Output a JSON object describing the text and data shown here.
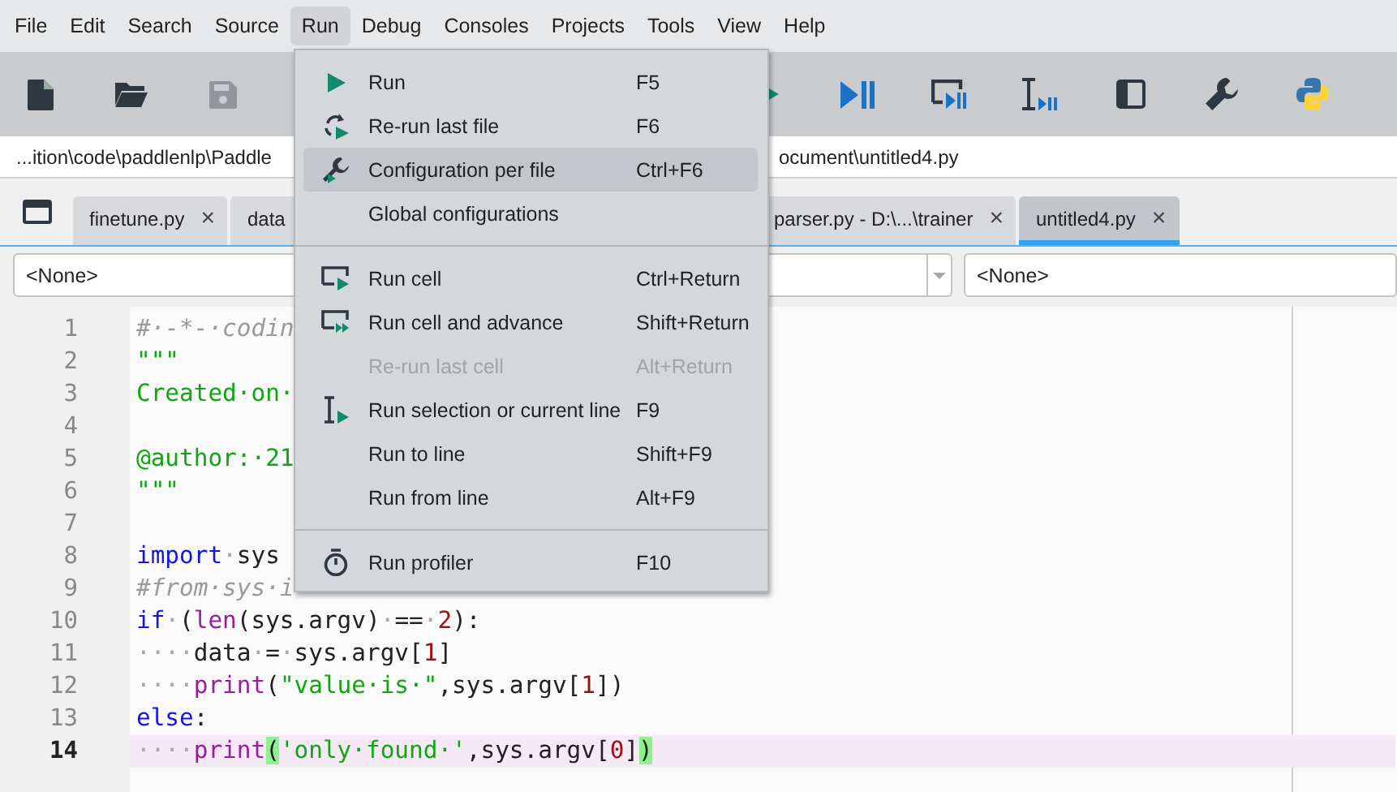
{
  "menubar": [
    {
      "label": "File",
      "selected": false
    },
    {
      "label": "Edit",
      "selected": false
    },
    {
      "label": "Search",
      "selected": false
    },
    {
      "label": "Source",
      "selected": false
    },
    {
      "label": "Run",
      "selected": true
    },
    {
      "label": "Debug",
      "selected": false
    },
    {
      "label": "Consoles",
      "selected": false
    },
    {
      "label": "Projects",
      "selected": false
    },
    {
      "label": "Tools",
      "selected": false
    },
    {
      "label": "View",
      "selected": false
    },
    {
      "label": "Help",
      "selected": false
    }
  ],
  "toolbar": {
    "left_buttons": [
      {
        "disabled": false
      },
      {
        "disabled": false
      },
      {
        "disabled": true
      }
    ],
    "right_buttons": [
      {
        "disabled": false
      },
      {
        "disabled": false
      },
      {
        "disabled": false
      },
      {
        "disabled": false
      },
      {
        "disabled": false
      },
      {
        "disabled": false
      },
      {
        "disabled": false
      }
    ]
  },
  "path_bar": {
    "text_left": "...ition\\code\\paddlenlp\\Paddle",
    "text_right": "ocument\\untitled4.py"
  },
  "tabs": [
    {
      "label": "finetune.py",
      "close": "×",
      "selected": false
    },
    {
      "label": "data",
      "selected": false
    },
    {
      "label": "parser.py - D:\\...\\trainer",
      "close": "×",
      "selected": false
    },
    {
      "label": "untitled4.py",
      "close": "×",
      "selected": true
    }
  ],
  "selectors": [
    {
      "value": "<None>"
    },
    {
      "value": "<None>"
    }
  ],
  "editor": {
    "lines": [
      {
        "number": "1",
        "current": false,
        "tokens": [
          {
            "kind": "comment",
            "text": "#·-*-·codin"
          }
        ]
      },
      {
        "number": "2",
        "current": false,
        "tokens": [
          {
            "kind": "string",
            "text": "\"\"\""
          }
        ]
      },
      {
        "number": "3",
        "current": false,
        "tokens": [
          {
            "kind": "string",
            "text": "Created·on·"
          }
        ]
      },
      {
        "number": "4",
        "current": false
      },
      {
        "number": "5",
        "current": false,
        "tokens": [
          {
            "kind": "string",
            "text": "@author:·21"
          }
        ]
      },
      {
        "number": "6",
        "current": false,
        "tokens": [
          {
            "kind": "string",
            "text": "\"\"\""
          }
        ]
      },
      {
        "number": "7",
        "current": false
      },
      {
        "number": "8",
        "current": false,
        "tokens": [
          {
            "kind": "keyword",
            "text": "import"
          },
          {
            "kind": "space",
            "text": "·"
          },
          {
            "kind": "plain",
            "text": "sys"
          }
        ]
      },
      {
        "number": "9",
        "current": false,
        "tokens": [
          {
            "kind": "comment",
            "text": "#from·sys·i"
          }
        ]
      },
      {
        "number": "10",
        "current": false,
        "tokens": [
          {
            "kind": "keyword",
            "text": "if"
          },
          {
            "kind": "space",
            "text": "·"
          },
          {
            "kind": "plain",
            "text": "("
          },
          {
            "kind": "builtin",
            "text": "len"
          },
          {
            "kind": "plain",
            "text": "(sys.argv)"
          },
          {
            "kind": "space",
            "text": "·"
          },
          {
            "kind": "plain",
            "text": "=="
          },
          {
            "kind": "space",
            "text": "·"
          },
          {
            "kind": "number",
            "text": "2"
          },
          {
            "kind": "plain",
            "text": "):"
          }
        ]
      },
      {
        "number": "11",
        "current": false,
        "tokens": [
          {
            "kind": "space",
            "text": "····"
          },
          {
            "kind": "plain",
            "text": "data"
          },
          {
            "kind": "space",
            "text": "·"
          },
          {
            "kind": "plain",
            "text": "="
          },
          {
            "kind": "space",
            "text": "·"
          },
          {
            "kind": "plain",
            "text": "sys.argv["
          },
          {
            "kind": "number",
            "text": "1"
          },
          {
            "kind": "plain",
            "text": "]"
          }
        ]
      },
      {
        "number": "12",
        "current": false,
        "tokens": [
          {
            "kind": "space",
            "text": "····"
          },
          {
            "kind": "builtin",
            "text": "print"
          },
          {
            "kind": "plain",
            "text": "("
          },
          {
            "kind": "string",
            "text": "\"value·is·\""
          },
          {
            "kind": "plain",
            "text": ",sys.argv["
          },
          {
            "kind": "number",
            "text": "1"
          },
          {
            "kind": "plain",
            "text": "])"
          }
        ]
      },
      {
        "number": "13",
        "current": false,
        "tokens": [
          {
            "kind": "keyword",
            "text": "else"
          },
          {
            "kind": "plain",
            "text": ":"
          }
        ]
      },
      {
        "number": "14",
        "current": true,
        "tokens": [
          {
            "kind": "space",
            "text": "····"
          },
          {
            "kind": "builtin",
            "text": "print"
          },
          {
            "kind": "match",
            "text": "("
          },
          {
            "kind": "string",
            "text": "'only·found·'"
          },
          {
            "kind": "plain",
            "text": ",sys.argv["
          },
          {
            "kind": "number",
            "text": "0"
          },
          {
            "kind": "plain",
            "text": "]"
          },
          {
            "kind": "match",
            "text": ")"
          }
        ]
      }
    ]
  },
  "run_menu": {
    "groups": [
      [
        {
          "label": "Run",
          "shortcut": "F5",
          "disabled": false,
          "selected": false
        },
        {
          "label": "Re-run last file",
          "shortcut": "F6",
          "disabled": false,
          "selected": false
        },
        {
          "label": "Configuration per file",
          "shortcut": "Ctrl+F6",
          "disabled": false,
          "selected": true
        },
        {
          "label": "Global configurations",
          "disabled": false,
          "selected": false
        }
      ],
      [
        {
          "label": "Run cell",
          "shortcut": "Ctrl+Return",
          "disabled": false,
          "selected": false
        },
        {
          "label": "Run cell and advance",
          "shortcut": "Shift+Return",
          "disabled": false,
          "selected": false
        },
        {
          "label": "Re-run last cell",
          "shortcut": "Alt+Return",
          "disabled": true,
          "selected": false
        },
        {
          "label": "Run selection or current line",
          "shortcut": "F9",
          "disabled": false,
          "selected": false
        },
        {
          "label": "Run to line",
          "shortcut": "Shift+F9",
          "disabled": false,
          "selected": false
        },
        {
          "label": "Run from line",
          "shortcut": "Alt+F9",
          "disabled": false,
          "selected": false
        }
      ],
      [
        {
          "label": "Run profiler",
          "shortcut": "F10",
          "disabled": false,
          "selected": false
        }
      ]
    ]
  }
}
